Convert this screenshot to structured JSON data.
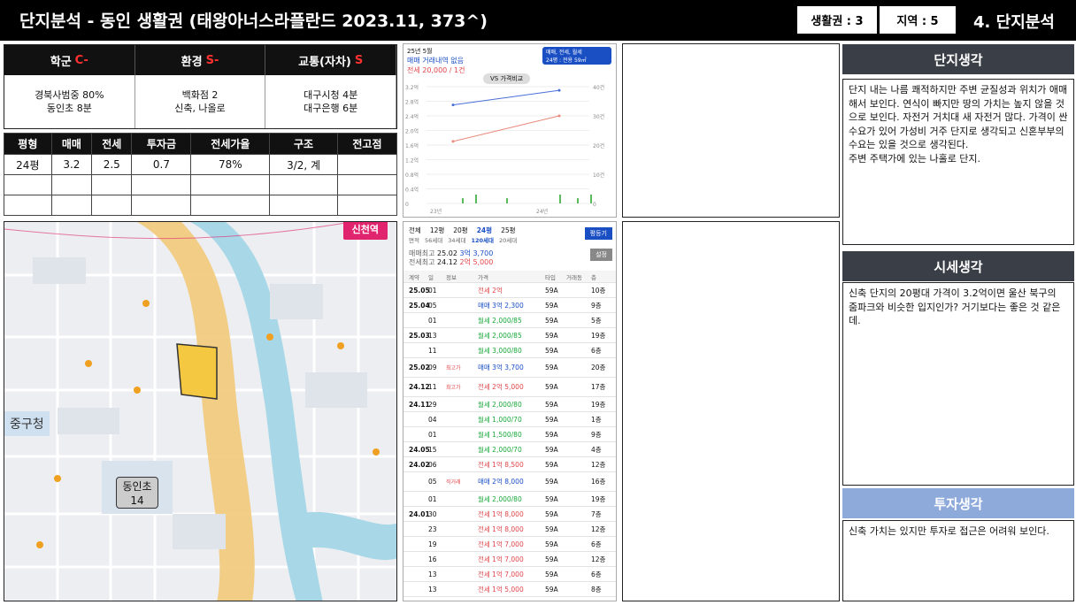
{
  "header": {
    "title": "단지분석 - 동인 생활권 (태왕아너스라플란드 2023.11, 373^)",
    "zone_label": "생활권 : 3",
    "region_label": "지역 : 5",
    "section": "4. 단지분석"
  },
  "grades": [
    {
      "label": "학군",
      "grade": "C-",
      "detail": [
        "경북사범중 80%",
        "동인초 8분"
      ]
    },
    {
      "label": "환경",
      "grade": "S-",
      "detail": [
        "백화점 2",
        "신축, 나올로"
      ]
    },
    {
      "label": "교통(자차)",
      "grade": "S",
      "detail": [
        "대구시청 4분",
        "대구은행 6분"
      ]
    }
  ],
  "stats": {
    "headers": [
      "평형",
      "매매",
      "전세",
      "투자금",
      "전세가율",
      "구조",
      "전고점"
    ],
    "rows": [
      [
        "24평",
        "3.2",
        "2.5",
        "0.7",
        "78%",
        "3/2, 계",
        ""
      ]
    ]
  },
  "map": {
    "station": "신천역",
    "office": "중구청",
    "school_name": "동인초",
    "school_count": "14",
    "highlight_color": "#f5c842"
  },
  "chart": {
    "period": "25년 5월",
    "no_trade": "매매 거래내역 없음",
    "jeonse": "전세 20,000 / 1건",
    "filter_label": "매매, 전세, 월세",
    "filter_sub": "24평 : 전용 59㎡",
    "vs_label": "VS 가격비교",
    "y_left": [
      "3.2억",
      "2.8억",
      "2.4억",
      "2.0억",
      "1.6억",
      "1.2억",
      "0.8억",
      "0.4억",
      "0"
    ],
    "y_right": [
      "40건",
      "30건",
      "20건",
      "10건",
      "0"
    ],
    "x_ticks": [
      "23년",
      "24년"
    ]
  },
  "chart_data": {
    "type": "line",
    "x": [
      "23년",
      "24년"
    ],
    "series": [
      {
        "name": "매매",
        "color": "#4a6fd8",
        "values": [
          2.7,
          3.1
        ]
      },
      {
        "name": "전세",
        "color": "#e88a7a",
        "values": [
          1.7,
          2.4
        ]
      }
    ]
  },
  "trades": {
    "tabs": [
      "전체",
      "12평",
      "20평",
      "24평",
      "25평"
    ],
    "subtabs": [
      "면적",
      "56세대",
      "34세대",
      "120세대",
      "20세대"
    ],
    "btn_area": "평등기",
    "max_sale_label": "매매최고",
    "max_sale_date": "25.02",
    "max_sale": "3억 3,700",
    "max_jeonse_label": "전세최고",
    "max_jeonse_date": "24.12",
    "max_jeonse": "2억 5,000",
    "btn_settings": "설정",
    "columns": [
      "계약",
      "일",
      "정보",
      "가격",
      "타입",
      "거래동",
      "층"
    ],
    "rows": [
      {
        "ym": "25.05",
        "d": "01",
        "badge": "",
        "price": "전세 2억",
        "kind": "jeonse",
        "type": "59A",
        "floor": "10층"
      },
      {
        "ym": "25.04",
        "d": "05",
        "badge": "",
        "price": "매매 3억 2,300",
        "kind": "sale",
        "type": "59A",
        "floor": "9층"
      },
      {
        "ym": "",
        "d": "01",
        "badge": "",
        "price": "월세 2,000/85",
        "kind": "rent",
        "type": "59A",
        "floor": "5층"
      },
      {
        "ym": "25.03",
        "d": "13",
        "badge": "",
        "price": "월세 2,000/85",
        "kind": "rent",
        "type": "59A",
        "floor": "19층"
      },
      {
        "ym": "",
        "d": "11",
        "badge": "",
        "price": "월세 3,000/80",
        "kind": "rent",
        "type": "59A",
        "floor": "6층"
      },
      {
        "ym": "25.02",
        "d": "09",
        "badge": "최고가",
        "price": "매매 3억 3,700",
        "kind": "sale",
        "type": "59A",
        "floor": "20층"
      },
      {
        "ym": "24.12",
        "d": "11",
        "badge": "최고가",
        "price": "전세 2억 5,000",
        "kind": "jeonse",
        "type": "59A",
        "floor": "17층"
      },
      {
        "ym": "24.11",
        "d": "29",
        "badge": "",
        "price": "월세 2,000/80",
        "kind": "rent",
        "type": "59A",
        "floor": "19층"
      },
      {
        "ym": "",
        "d": "04",
        "badge": "",
        "price": "월세 1,000/70",
        "kind": "rent",
        "type": "59A",
        "floor": "1층"
      },
      {
        "ym": "",
        "d": "01",
        "badge": "",
        "price": "월세 1,500/80",
        "kind": "rent",
        "type": "59A",
        "floor": "9층"
      },
      {
        "ym": "24.05",
        "d": "15",
        "badge": "",
        "price": "월세 2,000/70",
        "kind": "rent",
        "type": "59A",
        "floor": "4층"
      },
      {
        "ym": "24.02",
        "d": "06",
        "badge": "",
        "price": "전세 1억 8,500",
        "kind": "jeonse",
        "type": "59A",
        "floor": "12층"
      },
      {
        "ym": "",
        "d": "05",
        "badge": "직거래",
        "price": "매매 2억 8,000",
        "kind": "sale",
        "type": "59A",
        "floor": "16층"
      },
      {
        "ym": "",
        "d": "01",
        "badge": "",
        "price": "월세 2,000/80",
        "kind": "rent",
        "type": "59A",
        "floor": "19층"
      },
      {
        "ym": "24.01",
        "d": "30",
        "badge": "",
        "price": "전세 1억 8,000",
        "kind": "jeonse",
        "type": "59A",
        "floor": "7층"
      },
      {
        "ym": "",
        "d": "23",
        "badge": "",
        "price": "전세 1억 8,000",
        "kind": "jeonse",
        "type": "59A",
        "floor": "12층"
      },
      {
        "ym": "",
        "d": "19",
        "badge": "",
        "price": "전세 1억 7,000",
        "kind": "jeonse",
        "type": "59A",
        "floor": "6층"
      },
      {
        "ym": "",
        "d": "16",
        "badge": "",
        "price": "전세 1억 7,000",
        "kind": "jeonse",
        "type": "59A",
        "floor": "12층"
      },
      {
        "ym": "",
        "d": "13",
        "badge": "",
        "price": "전세 1억 7,000",
        "kind": "jeonse",
        "type": "59A",
        "floor": "6층"
      },
      {
        "ym": "",
        "d": "13",
        "badge": "",
        "price": "전세 1억 5,000",
        "kind": "jeonse",
        "type": "59A",
        "floor": "8층"
      }
    ]
  },
  "right": {
    "complex_title": "단지생각",
    "complex_text": "단지 내는 나름 쾌적하지만 주변 균질성과 위치가 애매해서 보인다. 연식이 빠지만 땅의 가치는 높지 않을 것으로 보인다. 자전거 거치대 새 자전거 많다. 가격이 싼 수요가 있어 가성비 거주 단지로 생각되고 신혼부부의 수요는 있을 것으로 생각된다.\n주변 주택가에 있는 나홀로 단지.",
    "price_title": "시세생각",
    "price_text": "신축 단지의 20평대 가격이 3.2억이면 울산 북구의 줌파크와 비슷한 입지인가? 거기보다는 좋은 것 같은데.",
    "invest_title": "투자생각",
    "invest_text": "신축 가치는 있지만 투자로 접근은 어려워 보인다.",
    "colors": {
      "dark": "#3a3f47",
      "light": "#8eaadb"
    }
  }
}
